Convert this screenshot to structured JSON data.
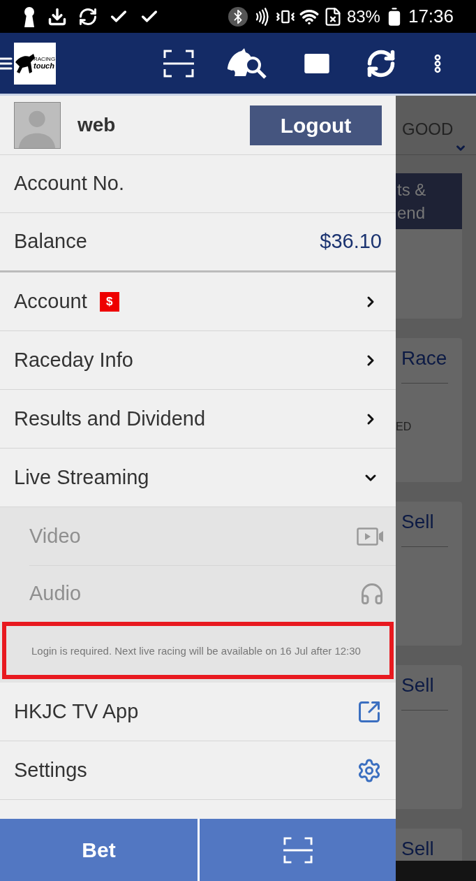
{
  "status_bar": {
    "battery": "83%",
    "time": "17:36"
  },
  "header": {
    "logo_lines": [
      "RACING",
      "touch"
    ]
  },
  "drawer": {
    "user": {
      "name": "web"
    },
    "logout": "Logout",
    "account_no": "Account No.",
    "balance": {
      "label": "Balance",
      "value": "$36.10"
    },
    "menu": [
      {
        "kind": "nav",
        "label": "Account",
        "badge": "$"
      },
      {
        "kind": "nav",
        "label": "Raceday Info"
      },
      {
        "kind": "nav",
        "label": "Results and Dividend"
      },
      {
        "kind": "expander",
        "label": "Live Streaming",
        "expanded": true,
        "children": [
          {
            "kind": "video",
            "label": "Video",
            "disabled": true
          },
          {
            "kind": "audio",
            "label": "Audio",
            "disabled": true
          }
        ],
        "notice": "Login is required. Next live racing will be available on 16 Jul after 12:30"
      },
      {
        "kind": "external",
        "label": "HKJC TV App"
      },
      {
        "kind": "settings",
        "label": "Settings"
      }
    ]
  },
  "bottom_bar": {
    "bet": "Bet"
  },
  "background": {
    "going": "GOOD",
    "cards": [
      {
        "kind": "banner",
        "lines": [
          "ts &",
          "end"
        ]
      },
      {
        "kind": "title",
        "title": "Race",
        "note": "ED"
      },
      {
        "kind": "title",
        "title": "Sell"
      },
      {
        "kind": "title",
        "title": "Sell"
      },
      {
        "kind": "title",
        "title": "Sell"
      }
    ]
  }
}
